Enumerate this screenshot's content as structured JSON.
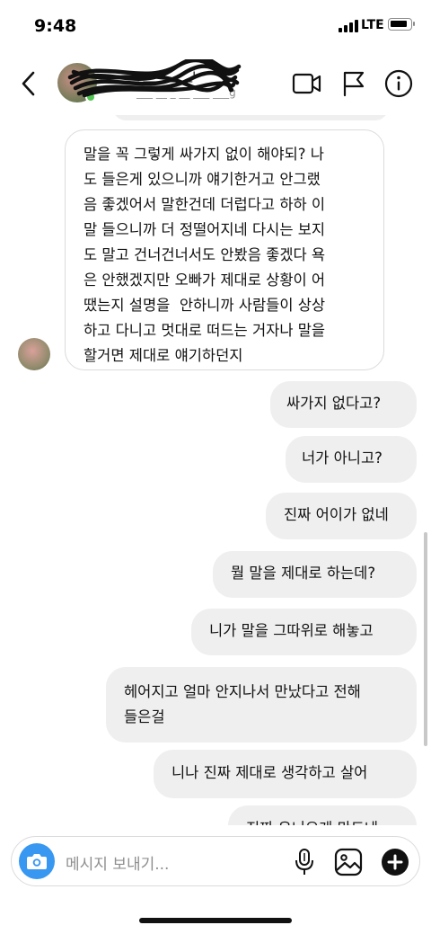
{
  "status_bar": {
    "time": "9:48",
    "network": "LTE"
  },
  "header": {
    "contact_name": "___ _ ___ __ _i",
    "contact_sub": "___ __ _ __ ___ ___g"
  },
  "messages": [
    {
      "sender": "them",
      "text": "말을 꼭 그렇게 싸가지 없이 해야되? 나\n도 들은게 있으니까 얘기한거고 안그랬\n음 좋겠어서 말한건데 더럽다고 하하 이\n말 들으니까 더 정떨어지네 다시는 보지\n도 말고 건너건너서도 안봤음 좋겠다 욕\n은 안했겠지만 오빠가 제대로 상황이 어\n땠는지 설명을  안하니까 사람들이 상상\n하고 다니고 멋대로 떠드는 거자나 말을\n할거면 제대로 얘기하던지"
    },
    {
      "sender": "me",
      "text": "싸가지 없다고?"
    },
    {
      "sender": "me",
      "text": "너가 아니고?"
    },
    {
      "sender": "me",
      "text": "진짜 어이가 없네"
    },
    {
      "sender": "me",
      "text": "뭘 말을 제대로 하는데?"
    },
    {
      "sender": "me",
      "text": "니가 말을 그따위로 해놓고"
    },
    {
      "sender": "me",
      "text": "헤어지고 얼마 안지나서 만났다고 전해\n들은걸"
    },
    {
      "sender": "me",
      "text": "니나 진짜 제대로 생각하고 살어"
    },
    {
      "sender": "me",
      "text": "진짜 우니오게 만드네"
    }
  ],
  "composer": {
    "placeholder": "메시지 보내기..."
  },
  "colors": {
    "accent": "#3897f0",
    "incoming_bubble": "#ffffff",
    "outgoing_bubble": "#efefef",
    "active_status": "#4fc64f"
  },
  "icons": [
    "back-chevron-icon",
    "video-call-icon",
    "flag-icon",
    "info-icon",
    "camera-icon",
    "microphone-icon",
    "gallery-icon",
    "plus-icon"
  ]
}
